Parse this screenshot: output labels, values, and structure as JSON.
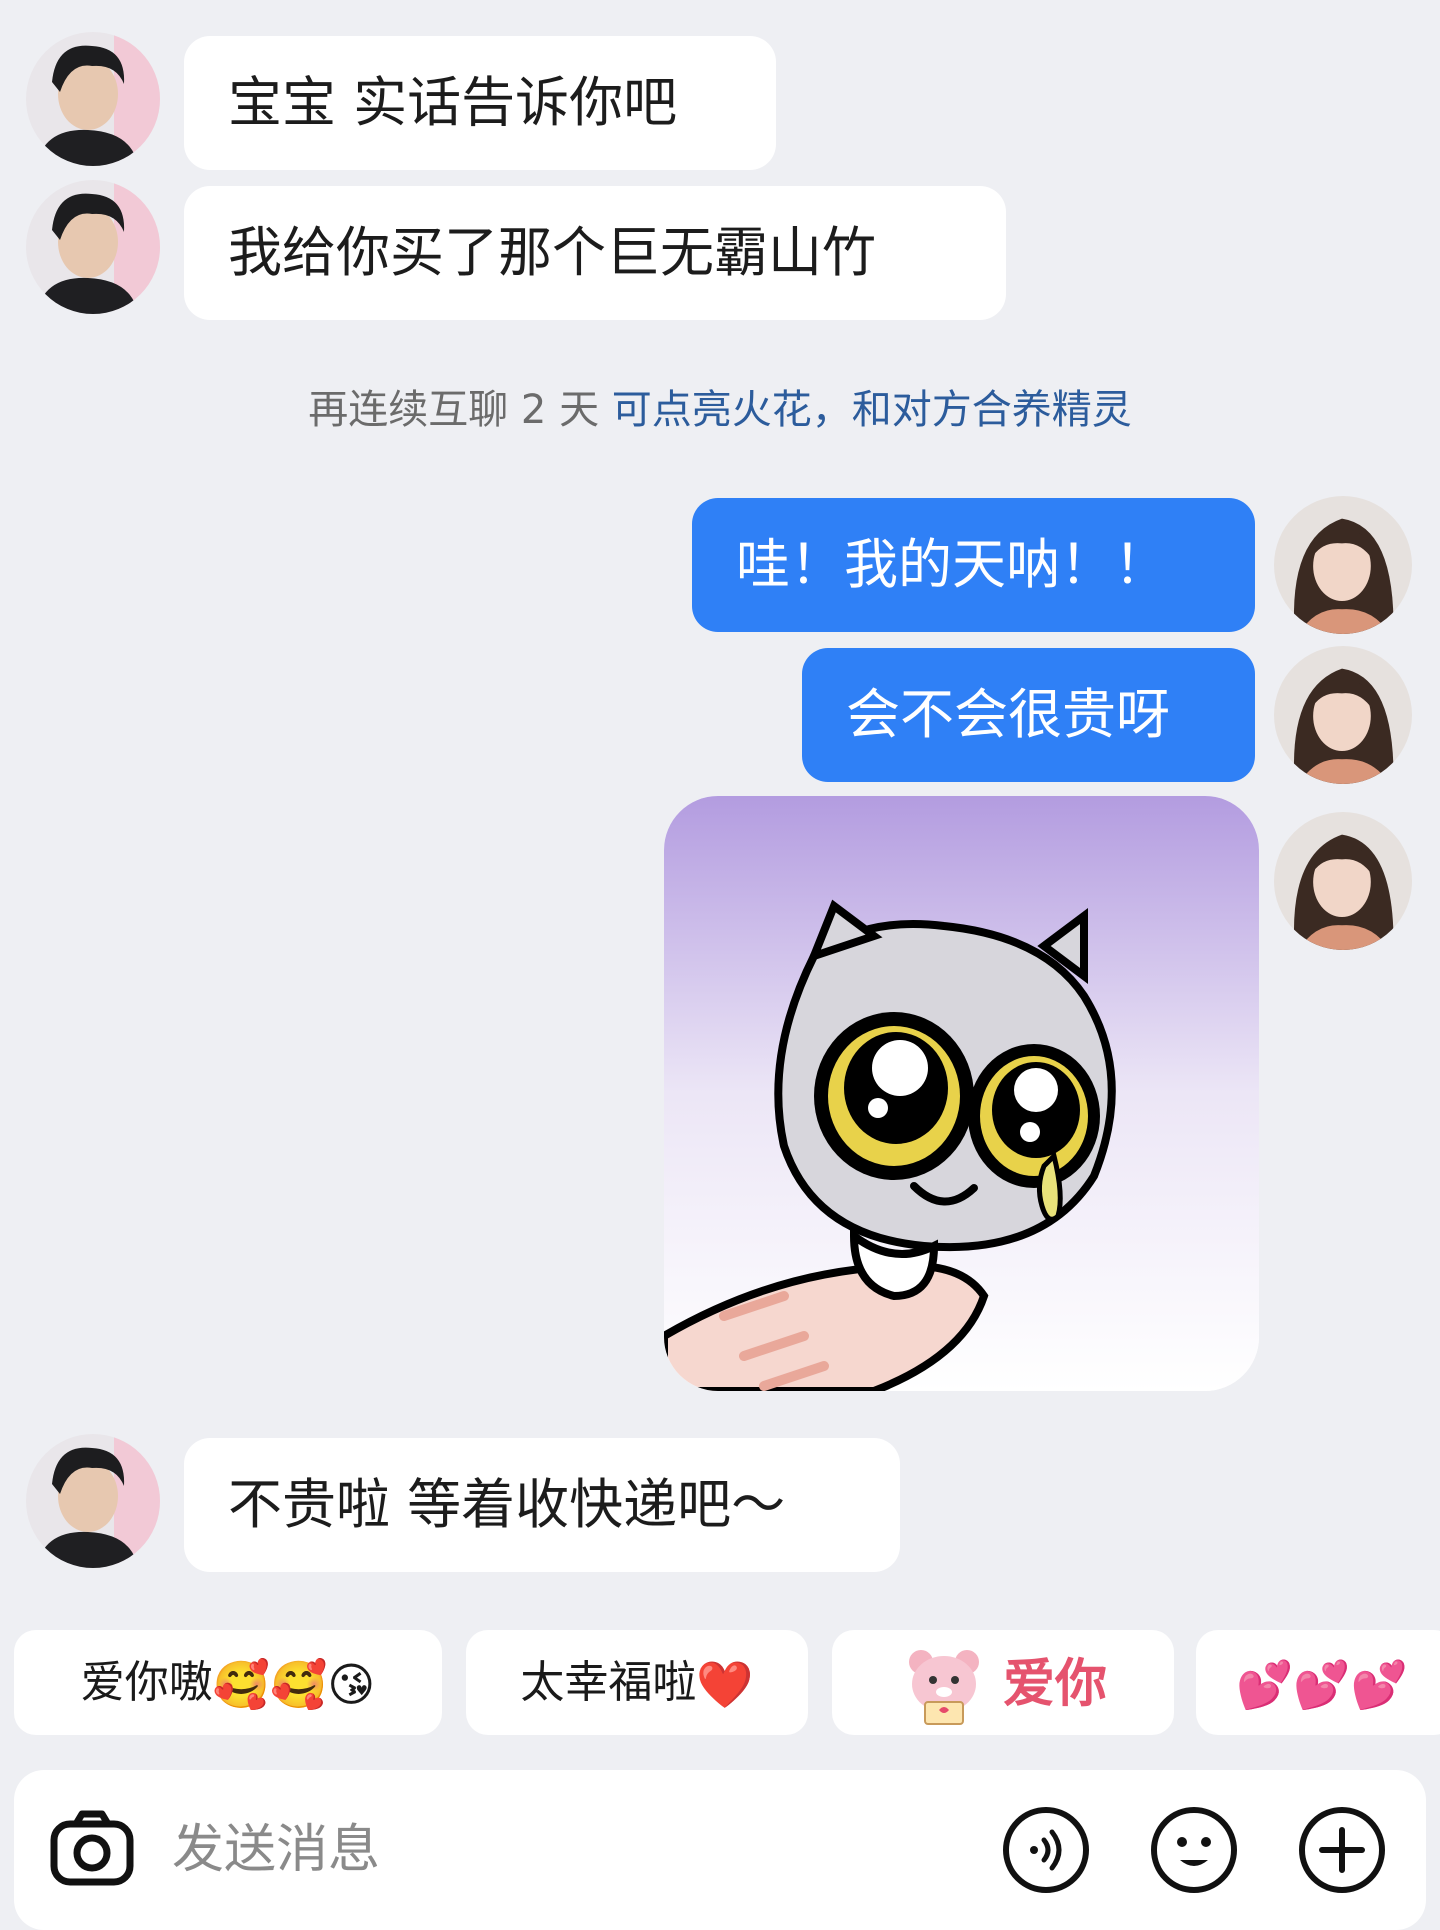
{
  "messages": [
    {
      "side": "in",
      "text": "宝宝 实话告诉你吧"
    },
    {
      "side": "in",
      "text": "我给你买了那个巨无霸山竹"
    },
    {
      "side": "out",
      "text": "哇！我的天呐！！"
    },
    {
      "side": "out",
      "text": "会不会很贵呀"
    },
    {
      "side": "in",
      "text": "不贵啦 等着收快递吧～"
    }
  ],
  "notice": {
    "prefix": "再连续互聊 2 天 ",
    "link": "可点亮火花，和对方合养精灵"
  },
  "quick_replies": [
    {
      "text": "爱你嗷",
      "emoji": "🥰🥰😘"
    },
    {
      "text": "太幸福啦",
      "emoji": "❤️"
    },
    {
      "text": "爱你",
      "emoji": ""
    },
    {
      "text": "",
      "emoji": "💕💕💕"
    }
  ],
  "input": {
    "placeholder": "发送消息"
  },
  "icons": {
    "camera": "camera-icon",
    "voice": "voice-icon",
    "emoji": "emoji-face-icon",
    "plus": "plus-icon"
  },
  "colors": {
    "background": "#eeeff3",
    "outgoing_bubble": "#2f80f6",
    "incoming_bubble": "#ffffff",
    "notice_link": "#2c5c9c"
  }
}
